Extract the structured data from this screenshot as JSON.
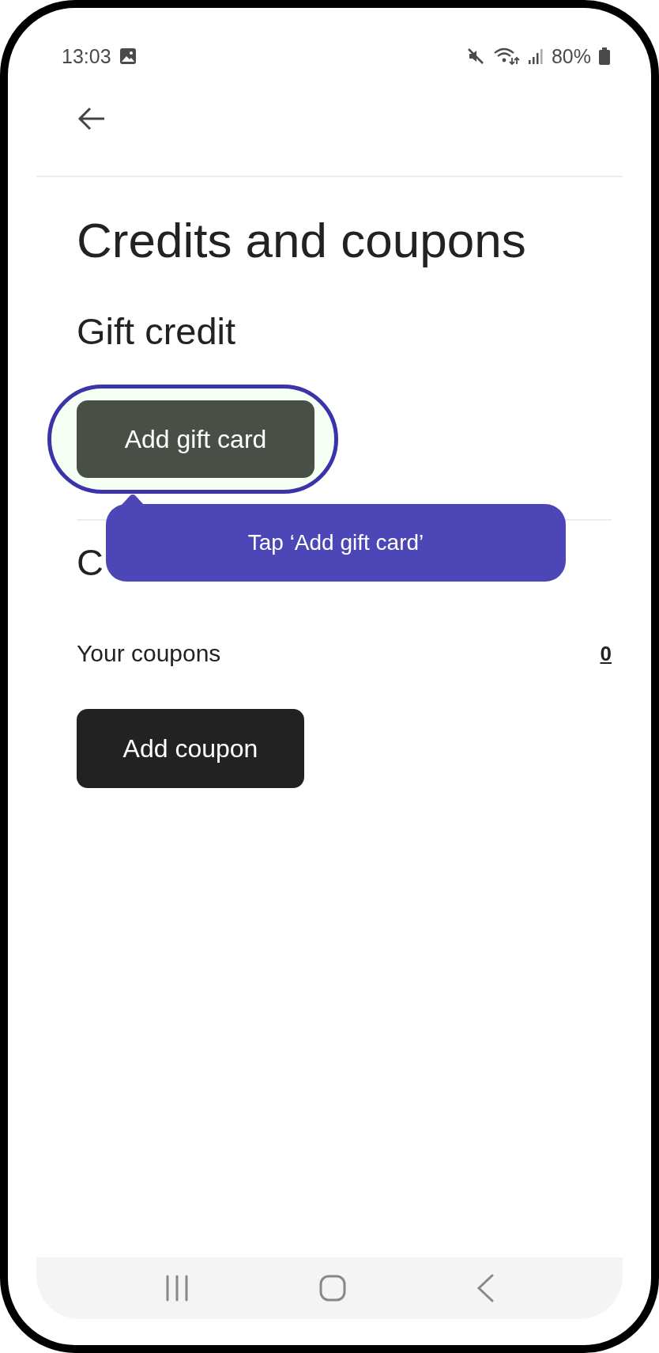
{
  "status_bar": {
    "time": "13:03",
    "battery": "80%"
  },
  "page": {
    "title": "Credits and coupons",
    "gift_section": {
      "heading": "Gift credit",
      "button": "Add gift card",
      "highlighted": true
    },
    "coupons_section": {
      "heading": "C",
      "row_label": "Your coupons",
      "row_value": "0",
      "button": "Add coupon"
    }
  },
  "tooltip": {
    "text": "Tap ‘Add gift card’"
  }
}
